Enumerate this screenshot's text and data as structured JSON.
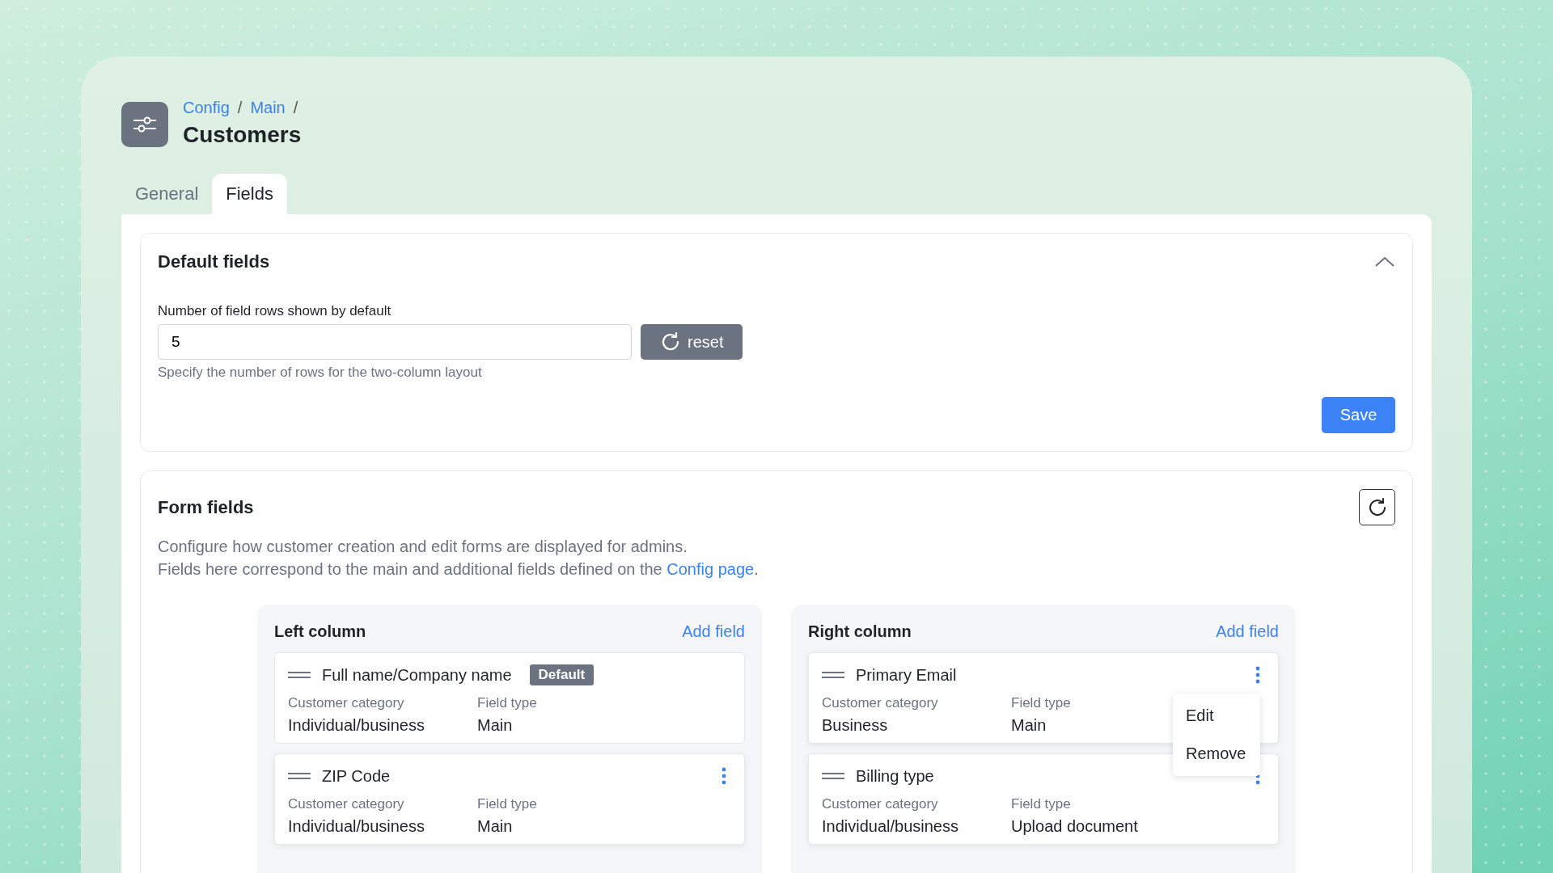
{
  "header": {
    "breadcrumb": [
      {
        "label": "Config",
        "separator": "/"
      },
      {
        "label": "Main",
        "separator": "/"
      }
    ],
    "title": "Customers"
  },
  "tabs": [
    {
      "label": "General",
      "selected": false
    },
    {
      "label": "Fields",
      "selected": true
    }
  ],
  "default_fields": {
    "title": "Default fields",
    "expanded": true,
    "field_label": "Number of field rows shown by default",
    "value": "5",
    "reset_label": "reset",
    "hint": "Specify the number of rows for the two-column layout",
    "save_label": "Save"
  },
  "form_fields": {
    "title": "Form fields",
    "description_line_1": "Configure how customer creation and edit forms are displayed for admins.",
    "description_line_2": "Fields here correspond to the main and additional fields defined on the",
    "link": "Config page",
    "after_link": ".",
    "columns": [
      {
        "title": "Left column",
        "add_label": "Add field",
        "fields": [
          {
            "name": "Full name/Company name",
            "badge": "Default",
            "menu_button": false,
            "category_label": "Customer category",
            "category": "Individual/business",
            "type_label": "Field type",
            "type": "Main"
          },
          {
            "name": "ZIP Code",
            "menu_button": true,
            "category_label": "Customer category",
            "category": "Individual/business",
            "type_label": "Field type",
            "type": "Main"
          }
        ]
      },
      {
        "title": "Right column",
        "add_label": "Add field",
        "fields": [
          {
            "name": "Primary Email",
            "menu_button": true,
            "menu_open": true,
            "menu": [
              "Edit",
              "Remove"
            ],
            "category_label": "Customer category",
            "category": "Business",
            "type_label": "Field type",
            "type": "Main"
          },
          {
            "name": "Billing type",
            "menu_button": true,
            "category_label": "Customer category",
            "category": "Individual/business",
            "type_label": "Field type",
            "type": "Upload document"
          }
        ]
      }
    ]
  }
}
